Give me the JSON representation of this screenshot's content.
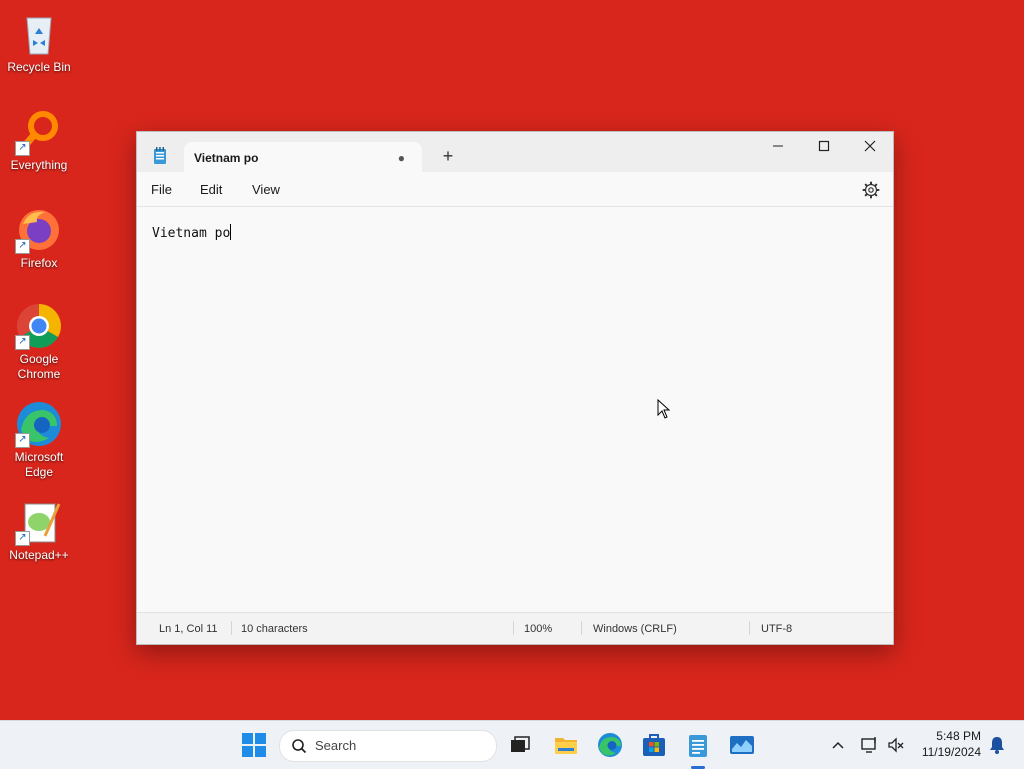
{
  "desktop": {
    "icons": [
      {
        "label": "Recycle Bin",
        "icon": "recycle-bin-icon"
      },
      {
        "label": "Everything",
        "icon": "everything-search-icon"
      },
      {
        "label": "Firefox",
        "icon": "firefox-icon"
      },
      {
        "label": "Google Chrome",
        "icon": "chrome-icon"
      },
      {
        "label": "Microsoft Edge",
        "icon": "edge-icon"
      },
      {
        "label": "Notepad++",
        "icon": "notepad-plus-plus-icon"
      }
    ],
    "background_color": "#d9261c"
  },
  "notepad": {
    "tab_title": "Vietnam po",
    "unsaved_indicator": "●",
    "new_tab": "+",
    "menu": {
      "file": "File",
      "edit": "Edit",
      "view": "View"
    },
    "content": "Vietnam po",
    "status": {
      "position": "Ln 1, Col 11",
      "characters": "10 characters",
      "zoom": "100%",
      "line_ending": "Windows (CRLF)",
      "encoding": "UTF-8"
    }
  },
  "taskbar": {
    "search_placeholder": "Search",
    "time": "5:48 PM",
    "date": "11/19/2024"
  }
}
